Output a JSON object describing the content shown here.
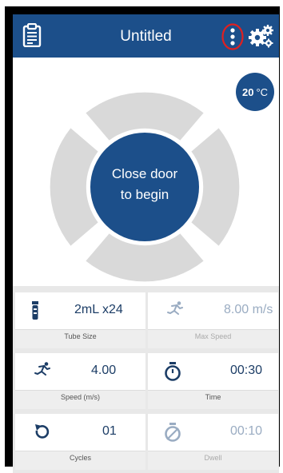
{
  "header": {
    "title": "Untitled"
  },
  "icons": [
    "clipboard-icon",
    "more-vertical-icon",
    "gears-icon",
    "tube-icon",
    "run-icon",
    "timer-icon",
    "repeat-icon",
    "no-timer-icon"
  ],
  "colors": {
    "primary": "#1c4f8a",
    "ring": "#d9d9d9",
    "highlight_circle": "#e02020"
  },
  "temperature": {
    "value": "20",
    "unit": "°C"
  },
  "center_button": {
    "line1": "Close door",
    "line2": "to begin"
  },
  "tiles": [
    {
      "value": "2mL x24",
      "label": "Tube Size",
      "enabled": true
    },
    {
      "value": "8.00 m/s",
      "label": "Max Speed",
      "enabled": false
    },
    {
      "value": "4.00",
      "label": "Speed (m/s)",
      "enabled": true
    },
    {
      "value": "00:30",
      "label": "Time",
      "enabled": true
    },
    {
      "value": "01",
      "label": "Cycles",
      "enabled": true
    },
    {
      "value": "00:10",
      "label": "Dwell",
      "enabled": false
    }
  ]
}
